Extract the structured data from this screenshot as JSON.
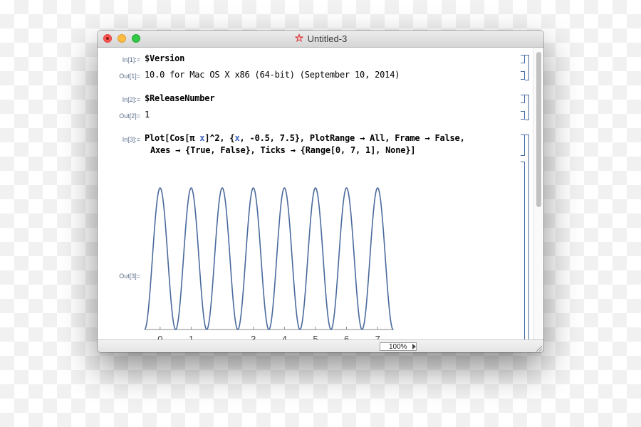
{
  "window": {
    "title": "Untitled-3"
  },
  "cells": [
    {
      "in_label": "In[1]:=",
      "input": "$Version",
      "out_label": "Out[1]=",
      "output": "10.0 for Mac OS X x86 (64-bit) (September 10, 2014)"
    },
    {
      "in_label": "In[2]:=",
      "input": "$ReleaseNumber",
      "out_label": "Out[2]=",
      "output": "1"
    },
    {
      "in_label": "In[3]:=",
      "input_line1_a": "Plot[Cos[π ",
      "input_line1_var": "x",
      "input_line1_b": "]^2, {",
      "input_line1_var2": "x",
      "input_line1_c": ", -0.5, 7.5}, PlotRange → All, Frame → False,",
      "input_line2": "Axes → {True, False}, Ticks → {Range[0, 7, 1], None}]",
      "out_label": "Out[3]="
    }
  ],
  "status": {
    "zoom": "100%"
  },
  "colors": {
    "curve": "#4a6a9c",
    "label": "#5a6e8a",
    "bracket": "#4a6fa6"
  },
  "chart_data": {
    "type": "line",
    "function": "Cos[π x]^2",
    "x_range": [
      -0.5,
      7.5
    ],
    "y_range": [
      0,
      1
    ],
    "frame": false,
    "x_axis": true,
    "y_axis": false,
    "x_ticks": [
      0,
      1,
      3,
      4,
      5,
      6,
      7
    ],
    "x_tick_labels": [
      "0",
      "1",
      "3",
      "4",
      "5",
      "6",
      "7"
    ],
    "series": [
      {
        "x": [
          -0.5,
          -0.25,
          0,
          0.25,
          0.5,
          0.75,
          1,
          1.25,
          1.5,
          1.75,
          2,
          2.25,
          2.5,
          2.75,
          3,
          3.25,
          3.5,
          3.75,
          4,
          4.25,
          4.5,
          4.75,
          5,
          5.25,
          5.5,
          5.75,
          6,
          6.25,
          6.5,
          6.75,
          7,
          7.25,
          7.5
        ],
        "y": [
          0,
          0.5,
          1,
          0.5,
          0,
          0.5,
          1,
          0.5,
          0,
          0.5,
          1,
          0.5,
          0,
          0.5,
          1,
          0.5,
          0,
          0.5,
          1,
          0.5,
          0,
          0.5,
          1,
          0.5,
          0,
          0.5,
          1,
          0.5,
          0,
          0.5,
          1,
          0.5,
          0
        ]
      }
    ]
  }
}
